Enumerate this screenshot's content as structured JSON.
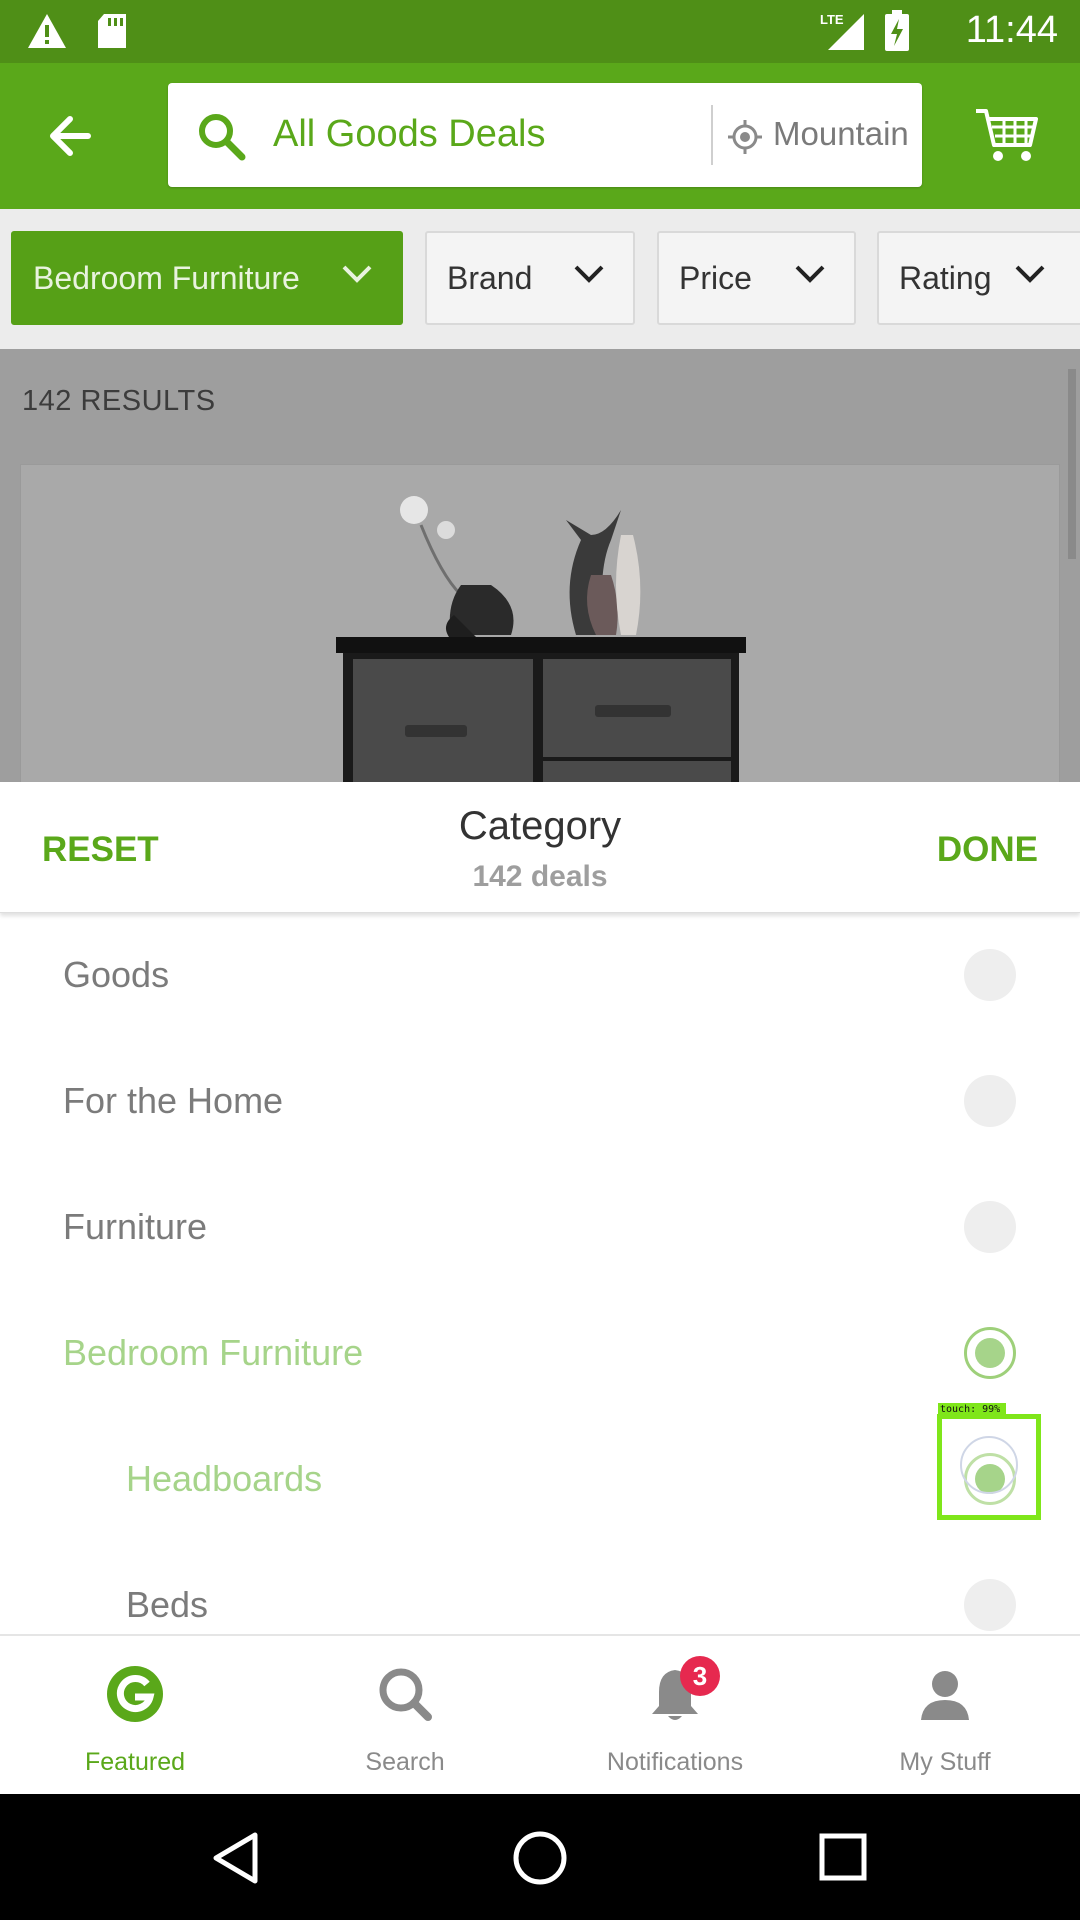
{
  "status_bar": {
    "time": "11:44",
    "network": "LTE"
  },
  "header": {
    "search_query": "All Goods Deals",
    "location": "Mountain"
  },
  "filters": [
    {
      "label": "Bedroom Furniture",
      "active": true
    },
    {
      "label": "Brand",
      "active": false
    },
    {
      "label": "Price",
      "active": false
    },
    {
      "label": "Rating",
      "active": false
    }
  ],
  "results": {
    "count_label": "142 RESULTS"
  },
  "sheet": {
    "title": "Category",
    "subtitle": "142 deals",
    "reset_label": "RESET",
    "done_label": "DONE",
    "categories": [
      {
        "label": "Goods",
        "selected": false
      },
      {
        "label": "For the Home",
        "selected": false
      },
      {
        "label": "Furniture",
        "selected": false
      },
      {
        "label": "Bedroom Furniture",
        "selected": true
      },
      {
        "label": "Headboards",
        "selected": true
      },
      {
        "label": "Beds",
        "selected": false
      }
    ]
  },
  "bottom_nav": {
    "items": [
      {
        "label": "Featured",
        "icon": "groupon-g-icon",
        "active": true
      },
      {
        "label": "Search",
        "icon": "search-icon",
        "active": false
      },
      {
        "label": "Notifications",
        "icon": "bell-icon",
        "active": false
      },
      {
        "label": "My Stuff",
        "icon": "person-icon",
        "active": false
      }
    ],
    "notifications_badge": "3"
  },
  "touch_indicator": {
    "label": "touch: 99%"
  },
  "colors": {
    "brand_green": "#5aa81a",
    "status_green": "#4f8f17",
    "badge_red": "#e6294f",
    "selected_light_green": "#a6d48a"
  }
}
